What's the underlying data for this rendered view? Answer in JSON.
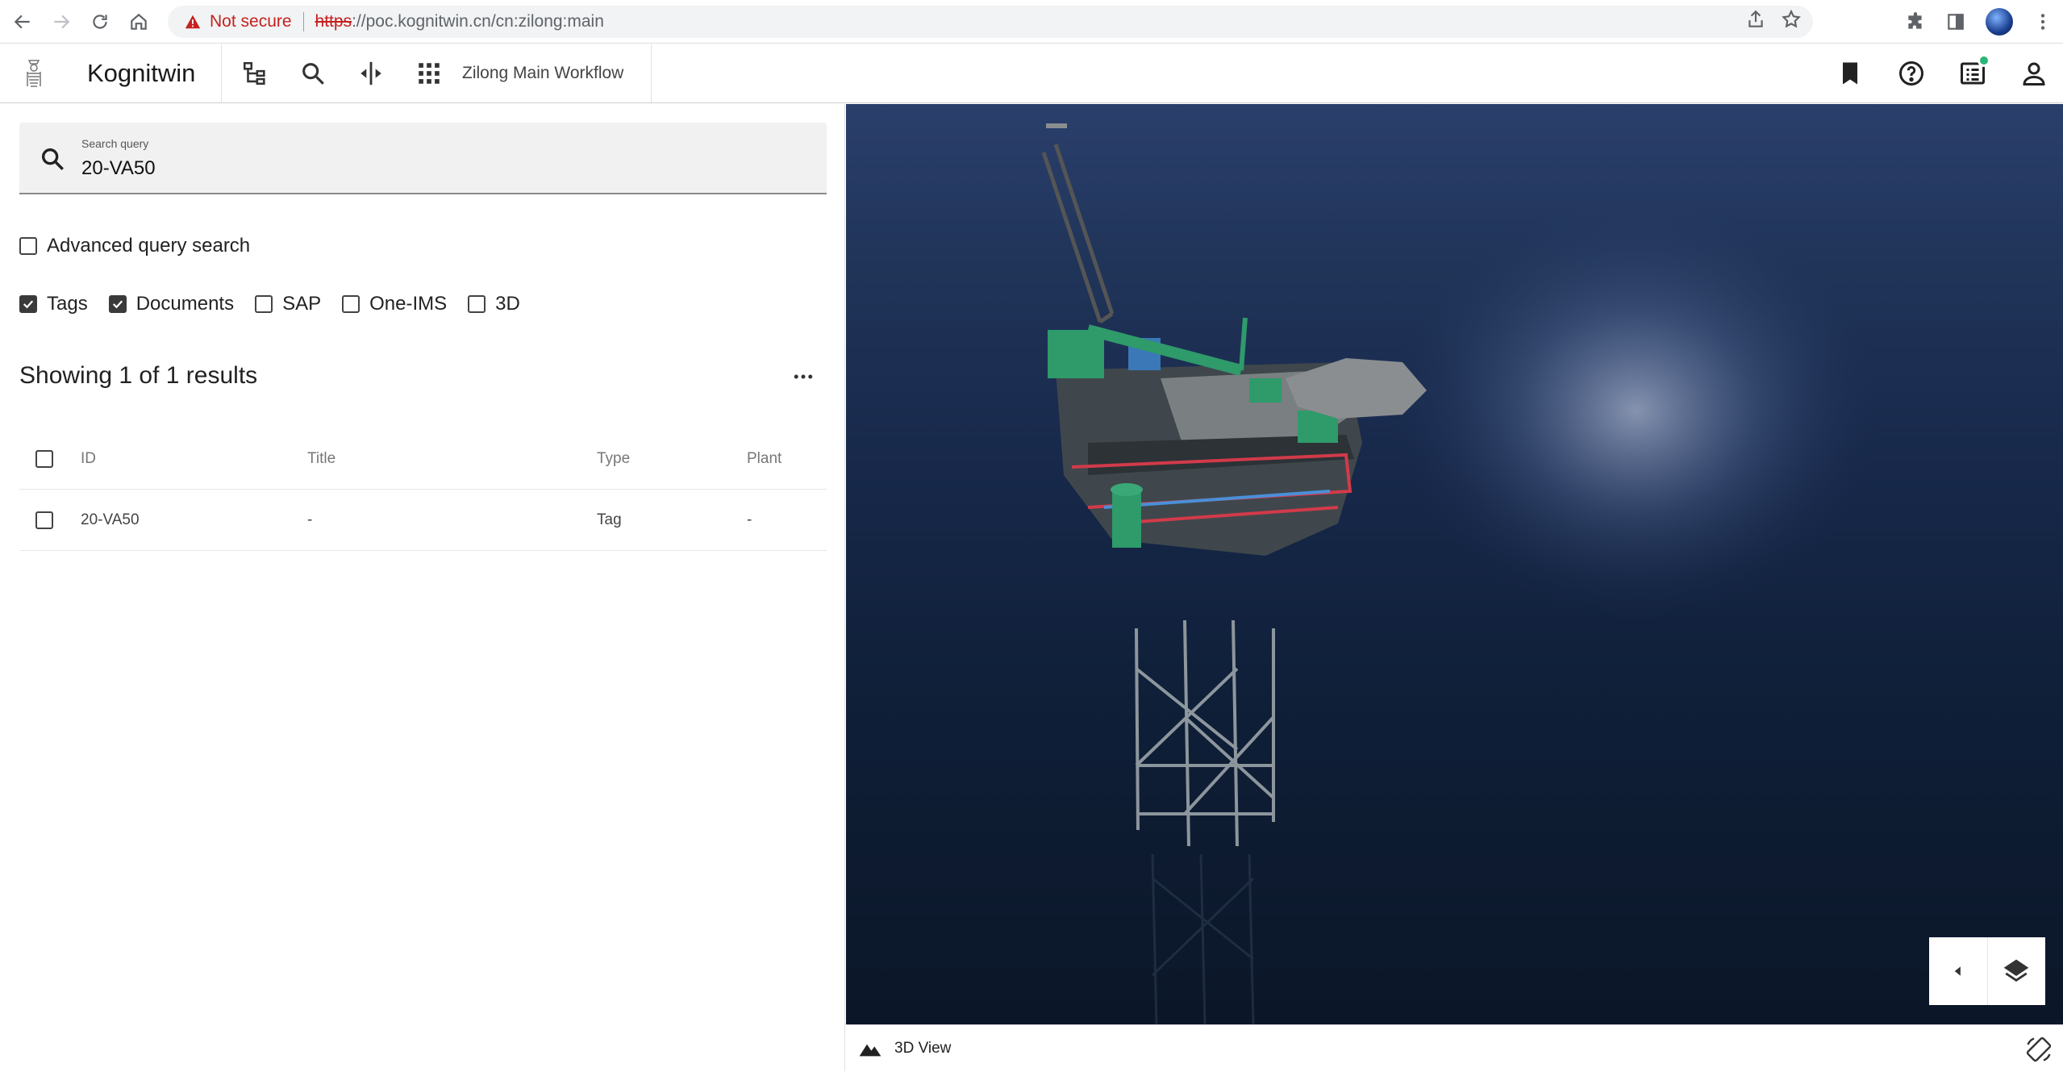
{
  "browser": {
    "security_label": "Not secure",
    "url_scheme": "https",
    "url_rest": "://poc.kognitwin.cn/cn:zilong:main"
  },
  "header": {
    "app_title": "Kognitwin",
    "workflow": "Zilong Main Workflow"
  },
  "search": {
    "label": "Search query",
    "value": "20-VA50"
  },
  "advanced": {
    "label": "Advanced query search",
    "checked": false
  },
  "filters": [
    {
      "label": "Tags",
      "checked": true
    },
    {
      "label": "Documents",
      "checked": true
    },
    {
      "label": "SAP",
      "checked": false
    },
    {
      "label": "One-IMS",
      "checked": false
    },
    {
      "label": "3D",
      "checked": false
    }
  ],
  "results": {
    "summary": "Showing 1 of 1 results",
    "columns": [
      "ID",
      "Title",
      "Type",
      "Plant"
    ],
    "rows": [
      {
        "id": "20-VA50",
        "title": "-",
        "type": "Tag",
        "plant": "-"
      }
    ]
  },
  "viewer": {
    "tab_label": "3D View"
  },
  "icons": {
    "back": "arrow-left-icon",
    "forward": "arrow-right-icon",
    "reload": "reload-icon",
    "home": "home-icon",
    "warning": "warning-triangle-icon",
    "share": "share-icon",
    "bookmark_star": "star-icon",
    "extensions": "puzzle-icon",
    "sidepanel": "side-panel-icon",
    "menu": "kebab-menu-icon",
    "hierarchy": "hierarchy-icon",
    "search": "search-icon",
    "split": "split-view-icon",
    "apps": "apps-grid-icon",
    "bookmark": "bookmark-icon",
    "help": "help-circle-icon",
    "tasks": "task-list-icon",
    "user": "user-icon",
    "more": "more-horizontal-icon",
    "collapse": "caret-left-icon",
    "layers": "layers-icon",
    "mountain": "mountain-icon",
    "rotate": "screen-rotate-icon"
  },
  "colors": {
    "insecure": "#c5221f",
    "notification": "#2bb673",
    "checkbox_checked": "#3a3a3a",
    "ocean_top": "#2a3f6b",
    "ocean_bottom": "#0b1628"
  }
}
